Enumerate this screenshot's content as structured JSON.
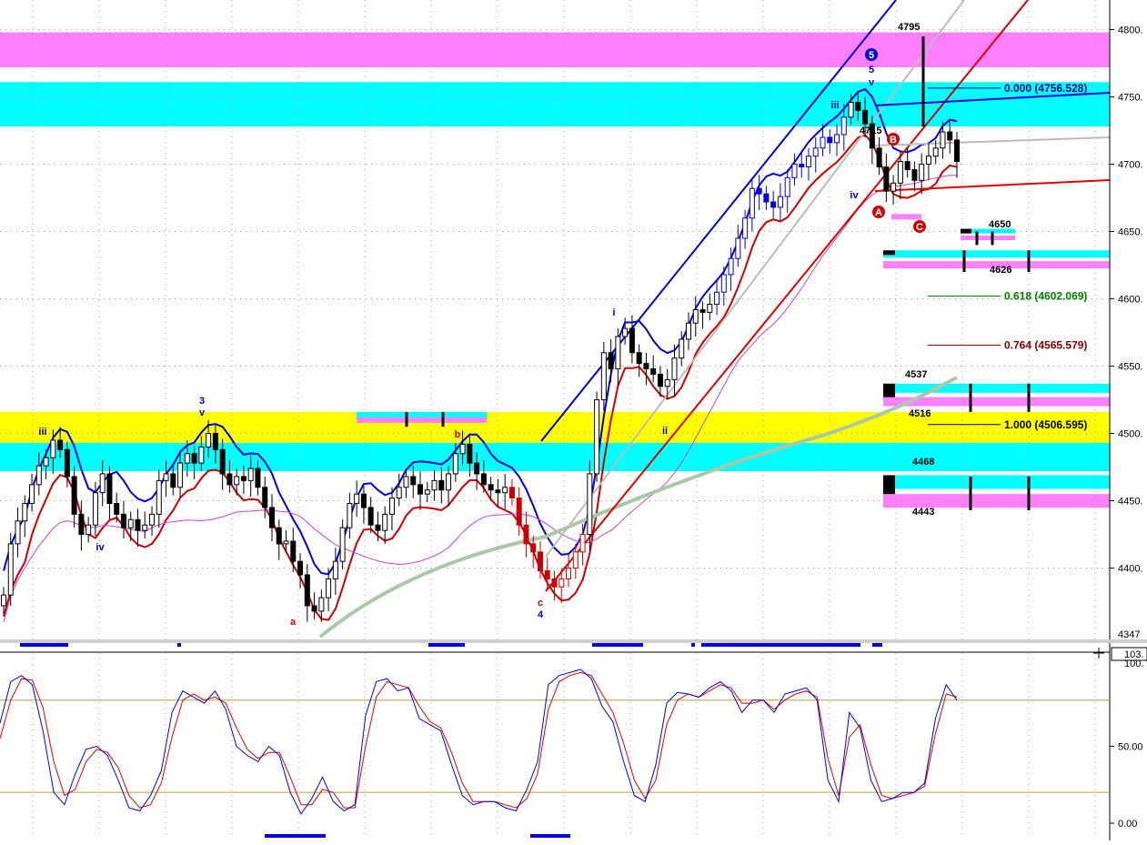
{
  "chart_data": {
    "type": "candlestick",
    "price_axis": {
      "ylim": [
        4347,
        4822
      ],
      "ticks": [
        "4800.",
        "4750.",
        "4700.",
        "4650.",
        "4600.",
        "4550.",
        "4500.",
        "4450.",
        "4400."
      ],
      "tick_values": [
        4800,
        4750,
        4700,
        4650,
        4600,
        4550,
        4500,
        4450,
        4400
      ],
      "bottom_label": "4347"
    },
    "stoch_axis": {
      "ylim": [
        0,
        103.5
      ],
      "ticks": [
        "0.00",
        "50.00"
      ],
      "tick_values": [
        0,
        50
      ],
      "top_label": "103.",
      "top_label2": "100."
    },
    "zones": [
      {
        "low": 4772,
        "high": 4798,
        "color": "#ff80ff",
        "name": "magenta-top"
      },
      {
        "low": 4728,
        "high": 4761,
        "color": "#00ffff",
        "name": "cyan-top"
      },
      {
        "low": 4493,
        "high": 4516,
        "color": "#ffff00",
        "name": "yellow-mid"
      },
      {
        "low": 4472,
        "high": 4493,
        "color": "#00ffff",
        "name": "cyan-mid"
      }
    ],
    "fib_levels": [
      {
        "label": "0.000 (4756.528)",
        "value": 4756.528,
        "color": "#000080"
      },
      {
        "label": "0.618 (4602.069)",
        "value": 4602.069,
        "color": "#008000"
      },
      {
        "label": "0.764 (4565.579)",
        "value": 4565.579,
        "color": "#800000"
      },
      {
        "label": "1.000 (4506.595)",
        "value": 4506.595,
        "color": "#000000"
      }
    ],
    "price_labels": [
      {
        "text": "4795",
        "value": 4795
      },
      {
        "text": "4650",
        "value": 4650
      },
      {
        "text": "4626",
        "value": 4626
      },
      {
        "text": "4537",
        "value": 4537
      },
      {
        "text": "4516",
        "value": 4516
      },
      {
        "text": "4468",
        "value": 4468
      },
      {
        "text": "4443",
        "value": 4443
      },
      {
        "text": "4715",
        "value": 4715
      }
    ],
    "wave_labels": [
      {
        "text": "iii",
        "x": 47,
        "y": 478,
        "color": "#0000cc"
      },
      {
        "text": "3",
        "x": 222,
        "y": 444,
        "color": "#0000cc"
      },
      {
        "text": "v",
        "x": 222,
        "y": 457,
        "color": "#0000cc"
      },
      {
        "text": "iv",
        "x": 110,
        "y": 605,
        "color": "#0000cc"
      },
      {
        "text": "a",
        "x": 322,
        "y": 687,
        "color": "#cc0000"
      },
      {
        "text": "b",
        "x": 503,
        "y": 481,
        "color": "#cc0000"
      },
      {
        "text": "c",
        "x": 594,
        "y": 666,
        "color": "#cc0000"
      },
      {
        "text": "4",
        "x": 594,
        "y": 679,
        "color": "#0000cc"
      },
      {
        "text": "i",
        "x": 675,
        "y": 347,
        "color": "#0000cc"
      },
      {
        "text": "ii",
        "x": 731,
        "y": 477,
        "color": "#0000cc"
      },
      {
        "text": "iii",
        "x": 918,
        "y": 119,
        "color": "#0000cc"
      },
      {
        "text": "iv",
        "x": 939,
        "y": 218,
        "color": "#0000cc"
      },
      {
        "text": "5",
        "x": 958,
        "y": 80,
        "color": "#0000cc"
      },
      {
        "text": "v",
        "x": 958,
        "y": 94,
        "color": "#0000cc"
      }
    ],
    "circle_labels": [
      {
        "text": "5",
        "x": 958,
        "y": 60,
        "color": "#0000cc"
      },
      {
        "text": "A",
        "x": 966,
        "y": 233,
        "color": "#cc0000"
      },
      {
        "text": "B",
        "x": 982,
        "y": 153,
        "color": "#cc0000"
      },
      {
        "text": "C",
        "x": 1011,
        "y": 249,
        "color": "#cc0000"
      }
    ],
    "candles_close": [
      4380,
      4418,
      4435,
      4448,
      4462,
      4476,
      4482,
      4495,
      4488,
      4468,
      4440,
      4425,
      4432,
      4456,
      4470,
      4448,
      4440,
      4430,
      4436,
      4428,
      4432,
      4440,
      4465,
      4470,
      4460,
      4478,
      4485,
      4478,
      4490,
      4500,
      4488,
      4470,
      4462,
      4468,
      4465,
      4474,
      4460,
      4445,
      4430,
      4418,
      4420,
      4405,
      4395,
      4372,
      4368,
      4378,
      4392,
      4405,
      4430,
      4448,
      4455,
      4445,
      4432,
      4428,
      4440,
      4452,
      4460,
      4468,
      4462,
      4455,
      4458,
      4465,
      4458,
      4470,
      4485,
      4492,
      4478,
      4470,
      4462,
      4458,
      4456,
      4460,
      4452,
      4432,
      4418,
      4412,
      4398,
      4392,
      4386,
      4392,
      4400,
      4412,
      4425,
      4470,
      4525,
      4560,
      4548,
      4572,
      4578,
      4560,
      4552,
      4548,
      4544,
      4535,
      4540,
      4556,
      4570,
      4582,
      4592,
      4590,
      4596,
      4605,
      4618,
      4630,
      4645,
      4660,
      4682,
      4678,
      4672,
      4668,
      4676,
      4690,
      4700,
      4698,
      4706,
      4712,
      4720,
      4716,
      4722,
      4735,
      4746,
      4740,
      4730,
      4712,
      4698,
      4680,
      4686,
      4702,
      4696,
      4688,
      4700,
      4706,
      4712,
      4724,
      4718,
      4702
    ],
    "stoch_k": [
      65,
      92,
      96,
      90,
      60,
      20,
      12,
      32,
      48,
      50,
      44,
      28,
      10,
      8,
      18,
      34,
      72,
      86,
      82,
      78,
      86,
      74,
      50,
      44,
      40,
      50,
      44,
      20,
      6,
      16,
      30,
      14,
      8,
      12,
      70,
      92,
      94,
      86,
      88,
      68,
      64,
      60,
      38,
      18,
      12,
      14,
      14,
      10,
      8,
      22,
      40,
      90,
      96,
      98,
      100,
      94,
      76,
      66,
      40,
      18,
      14,
      38,
      78,
      85,
      84,
      82,
      88,
      92,
      86,
      72,
      80,
      80,
      72,
      84,
      86,
      88,
      80,
      28,
      14,
      72,
      62,
      28,
      14,
      16,
      20,
      20,
      26,
      68,
      90,
      80
    ],
    "stoch_d": [
      55,
      80,
      94,
      93,
      75,
      40,
      18,
      22,
      40,
      48,
      46,
      36,
      18,
      10,
      12,
      26,
      56,
      80,
      84,
      80,
      82,
      78,
      62,
      48,
      42,
      46,
      46,
      30,
      12,
      12,
      22,
      20,
      10,
      10,
      50,
      82,
      92,
      90,
      88,
      76,
      66,
      62,
      46,
      26,
      14,
      14,
      14,
      12,
      10,
      16,
      32,
      74,
      92,
      96,
      98,
      96,
      84,
      72,
      52,
      28,
      16,
      28,
      64,
      80,
      84,
      82,
      86,
      90,
      88,
      78,
      78,
      80,
      74,
      80,
      84,
      86,
      82,
      42,
      18,
      56,
      64,
      38,
      18,
      16,
      18,
      20,
      24,
      58,
      84,
      82
    ]
  }
}
